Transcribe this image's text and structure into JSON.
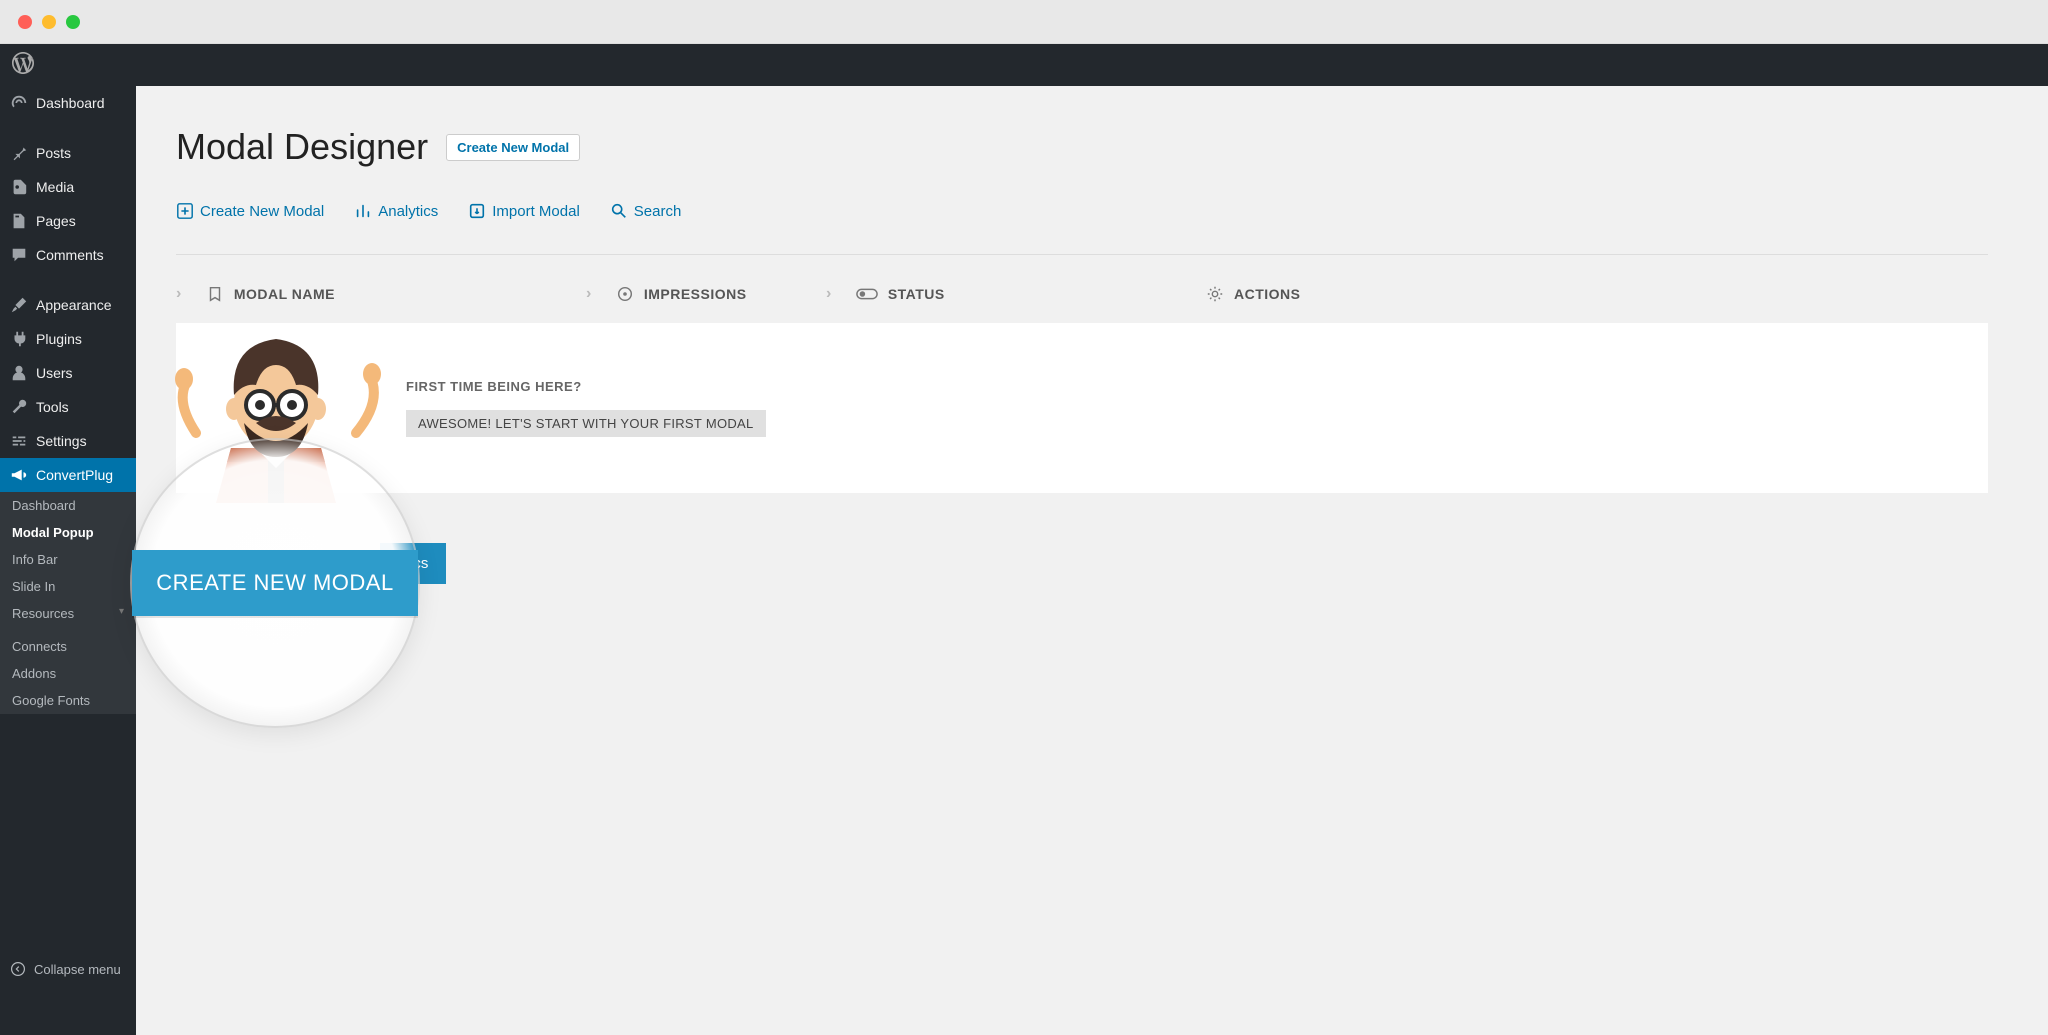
{
  "page": {
    "title": "Modal Designer",
    "head_button": "Create New Modal"
  },
  "toolbar": {
    "create": "Create New Modal",
    "analytics": "Analytics",
    "import": "Import Modal",
    "search": "Search"
  },
  "table": {
    "col_modal": "MODAL NAME",
    "col_impressions": "IMPRESSIONS",
    "col_status": "STATUS",
    "col_actions": "ACTIONS"
  },
  "empty_state": {
    "first_time": "FIRST TIME BEING HERE?",
    "awesome": "AWESOME! LET'S START WITH YOUR FIRST MODAL"
  },
  "bottom": {
    "analytics_btn": "ytics"
  },
  "spotlight": {
    "button": "CREATE NEW MODAL"
  },
  "sidebar": {
    "items": [
      {
        "label": "Dashboard"
      },
      {
        "label": "Posts"
      },
      {
        "label": "Media"
      },
      {
        "label": "Pages"
      },
      {
        "label": "Comments"
      },
      {
        "label": "Appearance"
      },
      {
        "label": "Plugins"
      },
      {
        "label": "Users"
      },
      {
        "label": "Tools"
      },
      {
        "label": "Settings"
      },
      {
        "label": "ConvertPlug"
      }
    ],
    "submenu": [
      {
        "label": "Dashboard"
      },
      {
        "label": "Modal Popup"
      },
      {
        "label": "Info Bar"
      },
      {
        "label": "Slide In"
      },
      {
        "label": "Resources"
      },
      {
        "label": "Connects"
      },
      {
        "label": "Addons"
      },
      {
        "label": "Google Fonts"
      }
    ],
    "collapse": "Collapse menu"
  }
}
